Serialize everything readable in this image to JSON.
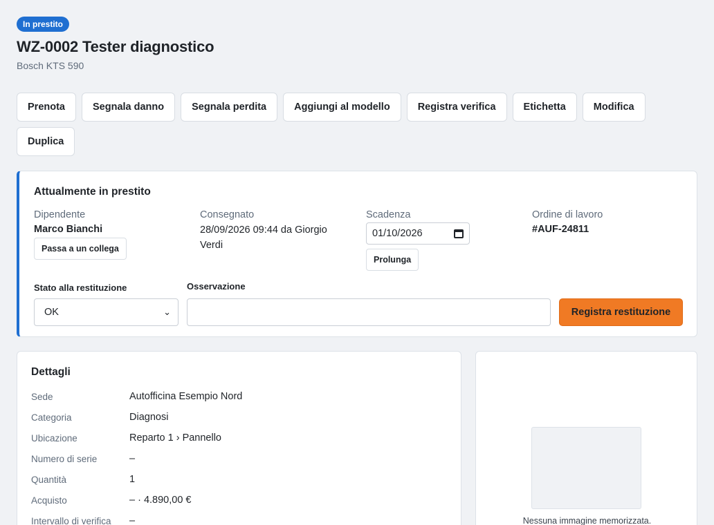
{
  "header": {
    "status_badge": "In prestito",
    "title": "WZ-0002 Tester diagnostico",
    "subtitle": "Bosch KTS 590"
  },
  "actions": [
    "Prenota",
    "Segnala danno",
    "Segnala perdita",
    "Aggiungi al modello",
    "Registra verifica",
    "Etichetta",
    "Modifica",
    "Duplica"
  ],
  "loan": {
    "title": "Attualmente in prestito",
    "employee_label": "Dipendente",
    "employee_value": "Marco Bianchi",
    "pass_button": "Passa a un collega",
    "handed_label": "Consegnato",
    "handed_value": "28/09/2026 09:44 da Giorgio Verdi",
    "due_label": "Scadenza",
    "due_value": "01/10/2026",
    "extend_button": "Prolunga",
    "order_label": "Ordine di lavoro",
    "order_value": "#AUF-24811",
    "return_state_label": "Stato alla restituzione",
    "return_state_value": "OK",
    "note_label": "Osservazione",
    "note_value": "",
    "register_button": "Registra restituzione"
  },
  "details": {
    "title": "Dettagli",
    "rows": [
      {
        "key": "Sede",
        "value": "Autofficina Esempio Nord"
      },
      {
        "key": "Categoria",
        "value": "Diagnosi"
      },
      {
        "key": "Ubicazione",
        "value": "Reparto 1 › Pannello"
      },
      {
        "key": "Numero di serie",
        "value": "–"
      },
      {
        "key": "Quantità",
        "value": "1"
      },
      {
        "key": "Acquisto",
        "value": "– · 4.890,00 €"
      },
      {
        "key": "Intervallo di verifica",
        "value": "–"
      }
    ]
  },
  "image": {
    "caption": "Nessuna immagine memorizzata."
  },
  "colors": {
    "accent": "#1f6fd1",
    "primary_button": "#f07a24",
    "background": "#f0f2f5"
  }
}
